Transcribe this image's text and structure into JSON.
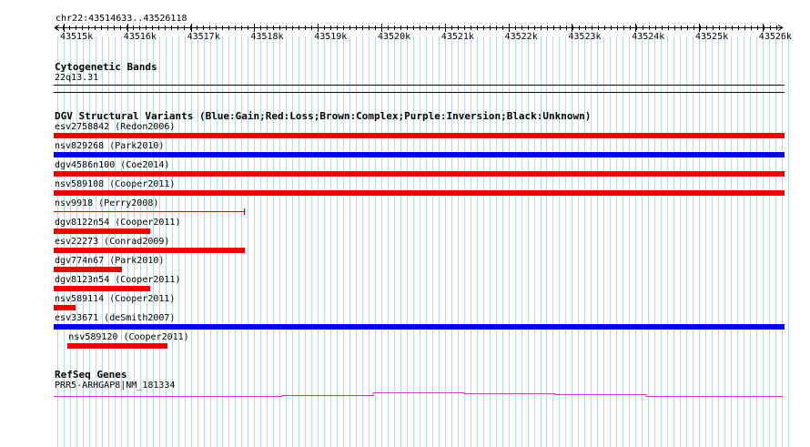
{
  "region": "chr22:43514633..43526118",
  "ruler": {
    "ticks": [
      "43515k",
      "43516k",
      "43517k",
      "43518k",
      "43519k",
      "43520k",
      "43521k",
      "43522k",
      "43523k",
      "43524k",
      "43525k",
      "43526k"
    ]
  },
  "cytoband": {
    "title": "Cytogenetic Bands",
    "band": "22q13.31"
  },
  "dgv": {
    "title": "DGV Structural Variants (Blue:Gain;Red:Loss;Brown:Complex;Purple:Inversion;Black:Unknown)",
    "colors": {
      "gain": "#0000ee",
      "loss": "#ee0000",
      "thin_loss": "#cc0000"
    },
    "variants": [
      {
        "label": "esv2758842 (Redon2006)",
        "type": "loss",
        "start": 0.0,
        "end": 1.0,
        "style": "thick"
      },
      {
        "label": "nsv829268 (Park2010)",
        "type": "gain",
        "start": 0.0,
        "end": 1.0,
        "style": "thick"
      },
      {
        "label": "dgv4586n100 (Coe2014)",
        "type": "loss",
        "start": 0.0,
        "end": 1.0,
        "style": "thick"
      },
      {
        "label": "nsv589108 (Cooper2011)",
        "type": "loss",
        "start": 0.0,
        "end": 1.0,
        "style": "thick"
      },
      {
        "label": "nsv9918 (Perry2008)",
        "type": "loss",
        "start": 0.0,
        "end": 0.262,
        "style": "thin"
      },
      {
        "label": "dgv8122n54 (Cooper2011)",
        "type": "loss",
        "start": 0.0,
        "end": 0.132,
        "style": "thick"
      },
      {
        "label": "esv22273 (Conrad2009)",
        "type": "loss",
        "start": 0.0,
        "end": 0.262,
        "style": "thick"
      },
      {
        "label": "dgv774n67 (Park2010)",
        "type": "loss",
        "start": 0.0,
        "end": 0.093,
        "style": "thick"
      },
      {
        "label": "dgv8123n54 (Cooper2011)",
        "type": "loss",
        "start": 0.0,
        "end": 0.132,
        "style": "thick"
      },
      {
        "label": "nsv589114 (Cooper2011)",
        "type": "loss",
        "start": 0.0,
        "end": 0.03,
        "style": "thick"
      },
      {
        "label": "esv33671 (deSmith2007)",
        "type": "gain",
        "start": 0.0,
        "end": 1.0,
        "style": "thick"
      },
      {
        "label": "nsv589120 (Cooper2011)",
        "type": "loss",
        "start": 0.019,
        "end": 0.156,
        "style": "thick"
      }
    ]
  },
  "refseq": {
    "title": "RefSeq Genes",
    "gene": "PRR5-ARHGAP8|NM_181334",
    "color": "#cc33cc"
  }
}
